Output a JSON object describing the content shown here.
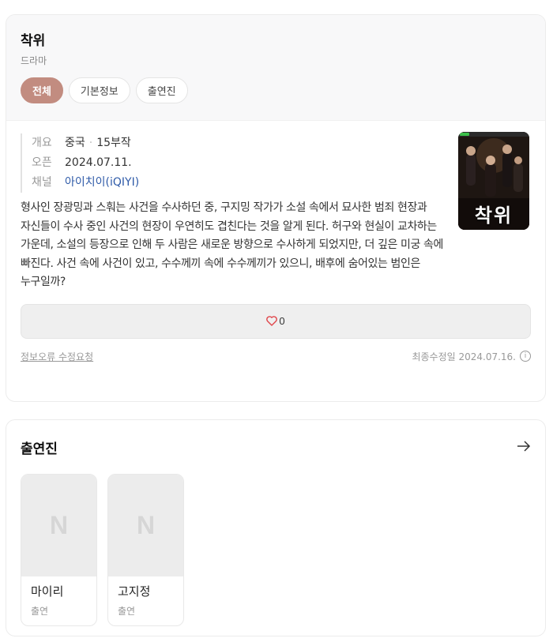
{
  "info": {
    "title": "착위",
    "genre": "드라마",
    "tabs": [
      {
        "label": "전체",
        "active": true
      },
      {
        "label": "기본정보",
        "active": false
      },
      {
        "label": "출연진",
        "active": false
      }
    ],
    "meta": {
      "overview_key": "개요",
      "overview_country": "중국",
      "overview_episodes": "15부작",
      "open_key": "오픈",
      "open_date": "2024.07.11.",
      "channel_key": "채널",
      "channel_value": "아이치이(iQIYI)"
    },
    "poster_text": "착위",
    "synopsis": "형사인 장광밍과 스훠는 사건을 수사하던 중, 구지밍 작가가 소설 속에서 묘사한 범죄 현장과 자신들이 수사 중인 사건의 현장이 우연히도 겹친다는 것을 알게 된다. 허구와 현실이 교차하는 가운데, 소설의 등장으로 인해 두 사람은 새로운 방향으로 수사하게 되었지만, 더 깊은 미궁 속에 빠진다. 사건 속에 사건이 있고, 수수께끼 속에 수수께끼가 있으니, 배후에 숨어있는 범인은 누구일까?",
    "like_count": "0",
    "report_link": "정보오류 수정요청",
    "updated_text": "최종수정일 2024.07.16.",
    "accent_color": "#c28c80"
  },
  "cast": {
    "title": "출연진",
    "members": [
      {
        "name": "마이리",
        "role": "출연",
        "placeholder": "N"
      },
      {
        "name": "고지정",
        "role": "출연",
        "placeholder": "N"
      }
    ]
  }
}
